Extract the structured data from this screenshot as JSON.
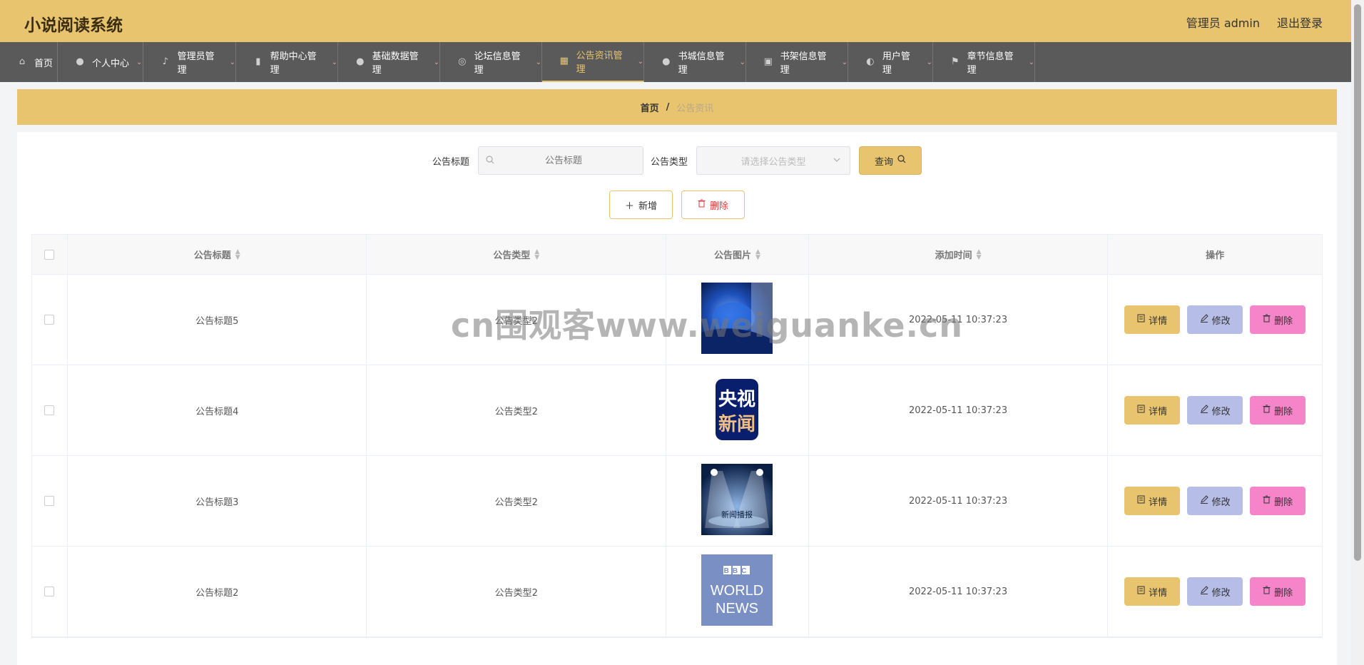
{
  "app": {
    "title": "小说阅读系统"
  },
  "header": {
    "user_label": "管理员 admin",
    "logout_label": "退出登录"
  },
  "nav": {
    "items": [
      {
        "label": "首页",
        "icon": "home-icon",
        "glyph": "⌂",
        "has_caret": false
      },
      {
        "label": "个人中心",
        "icon": "person-icon",
        "glyph": "●",
        "has_caret": true
      },
      {
        "label": "管理员管理",
        "icon": "mic-icon",
        "glyph": "♪",
        "has_caret": true
      },
      {
        "label": "帮助中心管理",
        "icon": "bar-chart-icon",
        "glyph": "▮",
        "has_caret": true
      },
      {
        "label": "基础数据管理",
        "icon": "user-icon",
        "glyph": "●",
        "has_caret": true
      },
      {
        "label": "论坛信息管理",
        "icon": "forum-icon",
        "glyph": "◎",
        "has_caret": true
      },
      {
        "label": "公告资讯管理",
        "icon": "grid-icon",
        "glyph": "▦",
        "has_caret": true,
        "active": true
      },
      {
        "label": "书城信息管理",
        "icon": "user-icon",
        "glyph": "●",
        "has_caret": true
      },
      {
        "label": "书架信息管理",
        "icon": "clipboard-icon",
        "glyph": "▣",
        "has_caret": true
      },
      {
        "label": "用户管理",
        "icon": "compass-icon",
        "glyph": "◐",
        "has_caret": true
      },
      {
        "label": "章节信息管理",
        "icon": "flag-icon",
        "glyph": "⚑",
        "has_caret": true
      }
    ],
    "widths": [
      81,
      120,
      130,
      143,
      143,
      143,
      143,
      143,
      143,
      119,
      143
    ]
  },
  "breadcrumb": {
    "home": "首页",
    "separator": "/",
    "current": "公告资讯"
  },
  "search": {
    "title_label": "公告标题",
    "title_placeholder": "公告标题",
    "type_label": "公告类型",
    "type_placeholder": "请选择公告类型",
    "query_label": "查询"
  },
  "actions": {
    "add_label": "新增",
    "delete_label": "删除"
  },
  "table": {
    "headers": {
      "title": "公告标题",
      "type": "公告类型",
      "image": "公告图片",
      "time": "添加时间",
      "ops": "操作"
    },
    "row_buttons": {
      "detail": "详情",
      "edit": "修改",
      "delete": "删除"
    },
    "rows": [
      {
        "title": "公告标题5",
        "type": "公告类型2",
        "time": "2022-05-11 10:37:23",
        "image": "blue-stage"
      },
      {
        "title": "公告标题4",
        "type": "公告类型2",
        "time": "2022-05-11 10:37:23",
        "image": "cctv-news"
      },
      {
        "title": "公告标题3",
        "type": "公告类型2",
        "time": "2022-05-11 10:37:23",
        "image": "news-broadcast"
      },
      {
        "title": "公告标题2",
        "type": "公告类型2",
        "time": "2022-05-11 10:37:23",
        "image": "bbc-world-news"
      }
    ],
    "thumb_texts": {
      "cctv_line1": "央视",
      "cctv_line2": "新闻",
      "broadcast": "新闻播报",
      "bbc_logo": "BBC",
      "bbc_line1": "WORLD",
      "bbc_line2": "NEWS"
    }
  },
  "watermark": "cn围观客www.weiguanke.cn",
  "colors": {
    "accent": "#e8c46e",
    "nav_bg": "#5a5a5a",
    "edit": "#b6bde6",
    "delete": "#f584c8"
  }
}
